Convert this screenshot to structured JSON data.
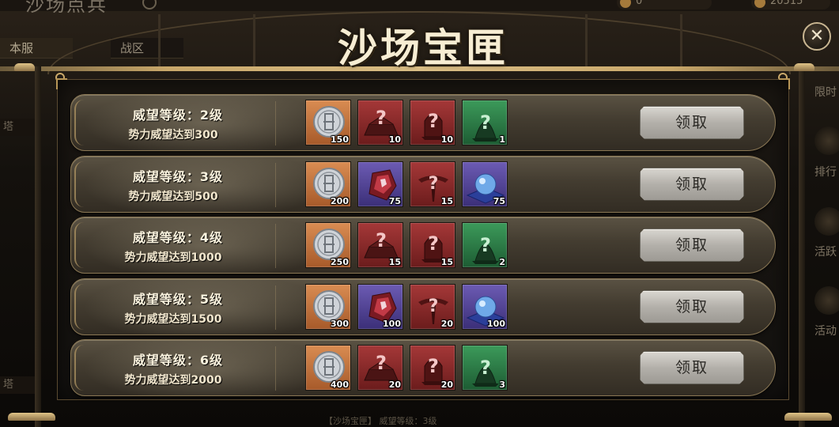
{
  "background": {
    "page_title": "沙场点兵",
    "resource_1": "0",
    "resource_2": "20515",
    "tabs": [
      "本服",
      "战区"
    ],
    "right_labels": [
      "限时",
      "排行",
      "活跃",
      "活动"
    ],
    "left_items": [
      "塔",
      "塔"
    ],
    "bottom_text": "【沙场宝匣】 威望等级：3级"
  },
  "dialog": {
    "title": "沙场宝匣",
    "close_icon": "close-icon",
    "claim_label": "领取",
    "rows": [
      {
        "level": "威望等级：2级",
        "requirement": "势力威望达到300",
        "rewards": [
          {
            "icon": "silver-coin-icon",
            "rarity": "orange",
            "qty": "150"
          },
          {
            "icon": "mystery-scroll-icon",
            "rarity": "red",
            "qty": "10"
          },
          {
            "icon": "mystery-helmet-icon",
            "rarity": "red",
            "qty": "10"
          },
          {
            "icon": "mystery-orb-icon",
            "rarity": "green",
            "qty": "1"
          }
        ]
      },
      {
        "level": "威望等级：3级",
        "requirement": "势力威望达到500",
        "rewards": [
          {
            "icon": "silver-coin-icon",
            "rarity": "orange",
            "qty": "200"
          },
          {
            "icon": "red-crystal-icon",
            "rarity": "purple",
            "qty": "75"
          },
          {
            "icon": "mystery-emblem-icon",
            "rarity": "red",
            "qty": "15"
          },
          {
            "icon": "blue-pearl-icon",
            "rarity": "purple",
            "qty": "75"
          }
        ]
      },
      {
        "level": "威望等级：4级",
        "requirement": "势力威望达到1000",
        "rewards": [
          {
            "icon": "silver-coin-icon",
            "rarity": "orange",
            "qty": "250"
          },
          {
            "icon": "mystery-scroll-icon",
            "rarity": "red",
            "qty": "15"
          },
          {
            "icon": "mystery-helmet-icon",
            "rarity": "red",
            "qty": "15"
          },
          {
            "icon": "mystery-orb-icon",
            "rarity": "green",
            "qty": "2"
          }
        ]
      },
      {
        "level": "威望等级：5级",
        "requirement": "势力威望达到1500",
        "rewards": [
          {
            "icon": "silver-coin-icon",
            "rarity": "orange",
            "qty": "300"
          },
          {
            "icon": "red-crystal-icon",
            "rarity": "purple",
            "qty": "100"
          },
          {
            "icon": "mystery-emblem-icon",
            "rarity": "red",
            "qty": "20"
          },
          {
            "icon": "blue-pearl-icon",
            "rarity": "purple",
            "qty": "100"
          }
        ]
      },
      {
        "level": "威望等级：6级",
        "requirement": "势力威望达到2000",
        "rewards": [
          {
            "icon": "silver-coin-icon",
            "rarity": "orange",
            "qty": "400"
          },
          {
            "icon": "mystery-scroll-icon",
            "rarity": "red",
            "qty": "20"
          },
          {
            "icon": "mystery-helmet-icon",
            "rarity": "red",
            "qty": "20"
          },
          {
            "icon": "mystery-orb-icon",
            "rarity": "green",
            "qty": "3"
          }
        ]
      }
    ]
  },
  "colors": {
    "gold_accent": "#c9a86a",
    "rarity_orange": "#d98c52",
    "rarity_red": "#a53838",
    "rarity_purple": "#6c5bb3",
    "rarity_green": "#3c9a5a"
  }
}
